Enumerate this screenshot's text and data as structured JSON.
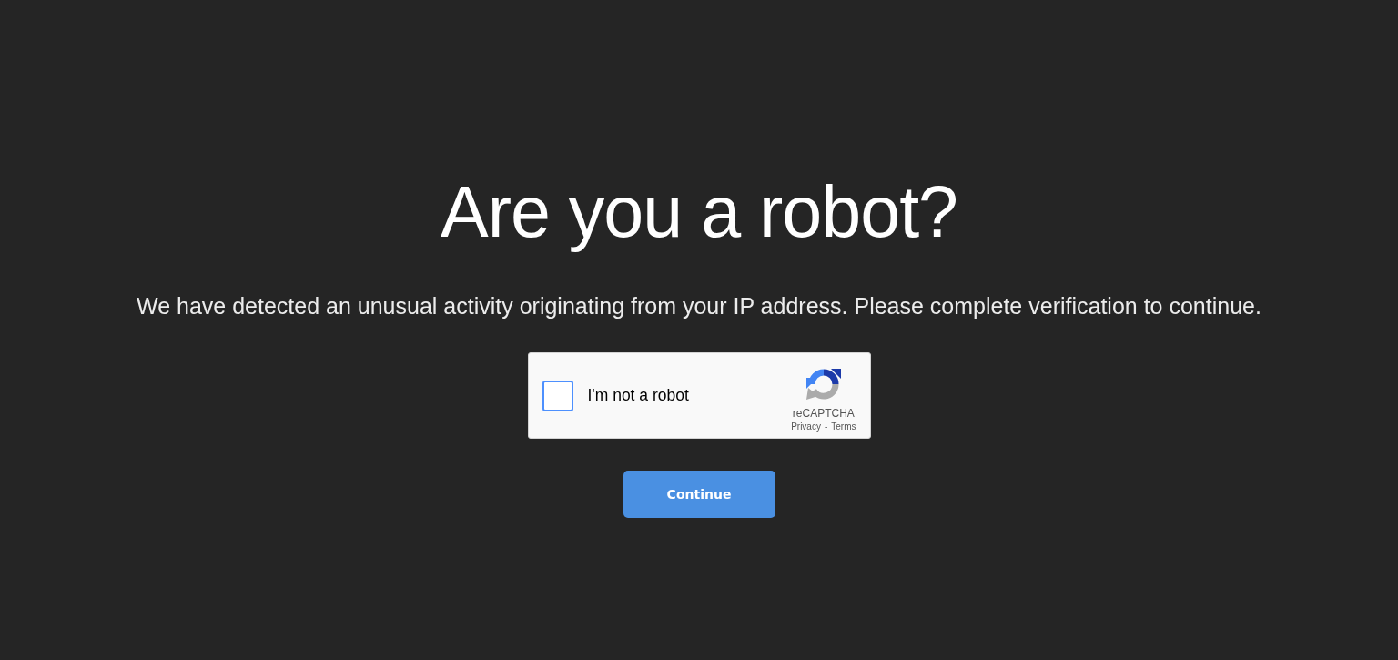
{
  "heading": "Are you a robot?",
  "message": "We have detected an unusual activity originating from your IP address. Please complete verification to continue.",
  "captcha": {
    "checkbox": {
      "label": "I'm not a robot",
      "checked": false
    },
    "brand": "reCAPTCHA",
    "links": [
      {
        "label": "Privacy"
      },
      {
        "label": "Terms"
      }
    ],
    "separator": "-"
  },
  "buttons": [
    {
      "label": "Continue"
    }
  ]
}
